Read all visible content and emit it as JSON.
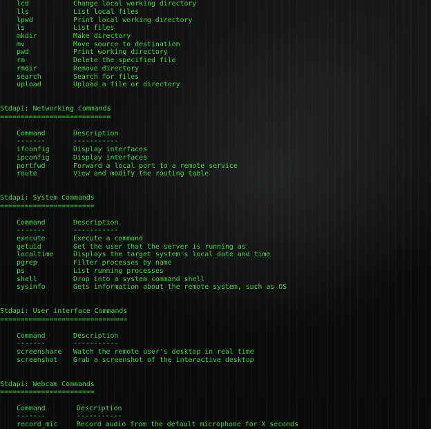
{
  "sections": {
    "fs_tail": {
      "rows": [
        {
          "cmd": "lcd",
          "desc": "Change local working directory"
        },
        {
          "cmd": "lls",
          "desc": "List local files"
        },
        {
          "cmd": "lpwd",
          "desc": "Print local working directory"
        },
        {
          "cmd": "ls",
          "desc": "List files"
        },
        {
          "cmd": "mkdir",
          "desc": "Make directory"
        },
        {
          "cmd": "mv",
          "desc": "Move source to destination"
        },
        {
          "cmd": "pwd",
          "desc": "Print working directory"
        },
        {
          "cmd": "rm",
          "desc": "Delete the specified file"
        },
        {
          "cmd": "rmdir",
          "desc": "Remove directory"
        },
        {
          "cmd": "search",
          "desc": "Search for files"
        },
        {
          "cmd": "upload",
          "desc": "Upload a file or directory"
        }
      ]
    },
    "networking": {
      "title": "Stdapi: Networking Commands",
      "rule": "===========================",
      "header_cmd": "Command",
      "header_desc": "Description",
      "header_cmd_rule": "-------",
      "header_desc_rule": "-----------",
      "rows": [
        {
          "cmd": "ifconfig",
          "desc": "Display interfaces"
        },
        {
          "cmd": "ipconfig",
          "desc": "Display interfaces"
        },
        {
          "cmd": "portfwd",
          "desc": "Forward a local port to a remote service"
        },
        {
          "cmd": "route",
          "desc": "View and modify the routing table"
        }
      ]
    },
    "system": {
      "title": "Stdapi: System Commands",
      "rule": "=======================",
      "header_cmd": "Command",
      "header_desc": "Description",
      "header_cmd_rule": "-------",
      "header_desc_rule": "-----------",
      "rows": [
        {
          "cmd": "execute",
          "desc": "Execute a command"
        },
        {
          "cmd": "getuid",
          "desc": "Get the user that the server is running as"
        },
        {
          "cmd": "localtime",
          "desc": "Displays the target system's local date and time"
        },
        {
          "cmd": "pgrep",
          "desc": "Filter processes by name"
        },
        {
          "cmd": "ps",
          "desc": "List running processes"
        },
        {
          "cmd": "shell",
          "desc": "Drop into a system command shell"
        },
        {
          "cmd": "sysinfo",
          "desc": "Gets information about the remote system, such as OS"
        }
      ]
    },
    "ui": {
      "title": "Stdapi: User interface Commands",
      "rule": "===============================",
      "header_cmd": "Command",
      "header_desc": "Description",
      "header_cmd_rule": "-------",
      "header_desc_rule": "-----------",
      "rows": [
        {
          "cmd": "screenshare",
          "desc": "Watch the remote user's desktop in real time"
        },
        {
          "cmd": "screenshot",
          "desc": "Grab a screenshot of the interactive desktop"
        }
      ]
    },
    "webcam": {
      "title": "Stdapi: Webcam Commands",
      "rule": "=======================",
      "header_cmd": "Command",
      "header_desc": "Description",
      "header_cmd_rule": "-------",
      "header_desc_rule": "-----------",
      "rows": [
        {
          "cmd": "record_mic",
          "desc": "Record audio from the default microphone for X seconds"
        }
      ]
    }
  },
  "colors": {
    "terminal_text": "#3ed43e",
    "background": "#0d0f0e"
  }
}
